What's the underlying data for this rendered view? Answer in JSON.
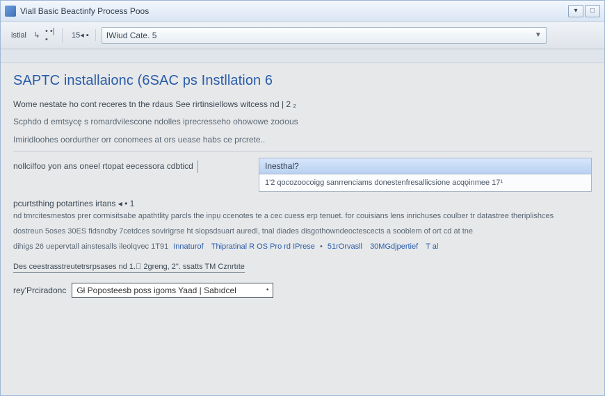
{
  "window": {
    "title": "Viall Basic Beactinfy Process Poos"
  },
  "toolbar": {
    "group1_label": "istial",
    "group1_arrow": "↳",
    "group1_dots": "• •| •",
    "group2_label": "15◂ ▪",
    "dropdown_text": "IWiud Cate. 5"
  },
  "page": {
    "heading": "SAPTC installaionc (6SAC ps Instllation 6",
    "para1": "Wome nestate ho cont receres tn the rdaus See rirtinsiellows witcess nd | 2 ₂",
    "para2": "Scphdo d emtsycę s romardvilescone ndolles iprecresseho ohowowe ᴢoσous",
    "para3": "Imiridloohes oordurther orr conomees at ors uease habs ce prcrete..",
    "left_caption": "nollcilfoo yon ans oneel rtopat eecessora cdbticd",
    "install_head": "Inesthal?",
    "install_body": "1'2 qocoᴢoocoigg sanrrenciams donestenfresallicsione acqǫinmee 17¹",
    "section_label": "pcurtsthing potartines irtans ◂ • 1",
    "body_line1": "nd tmrcitesmestos prer cormisitsabe apathtlity parcls the inpụ ccenotes te a cec cuess erp tenuet. for couisians lens inrichuses coulber tr datastree theriplishces",
    "body_line2": "dostreun 5oses 30ES fidsndby 7cetdces sovirigrse ht slopsdsuart auredl, tnal diades disgothowndeoctescects a sooblem of ort cd at tne",
    "link_prefix": "dihigs 26 uepervtall ainstesalls ileolqvec 1T91",
    "links": [
      "Innaturof",
      "Thipratinal R OS Pro rd IPrese",
      "51rOrvasll",
      "30MGdjpertief",
      "T al"
    ],
    "footline": "Des ceestrasstreutetrsrpsases nd 1.᳝ 2greng, 2\". ssatts TM Cᴢnrtıte",
    "bottom_label": "rey'Prciradonc",
    "combo_text": "Gł Poposteesb poss igoms Yaad | Sabıdcel"
  }
}
